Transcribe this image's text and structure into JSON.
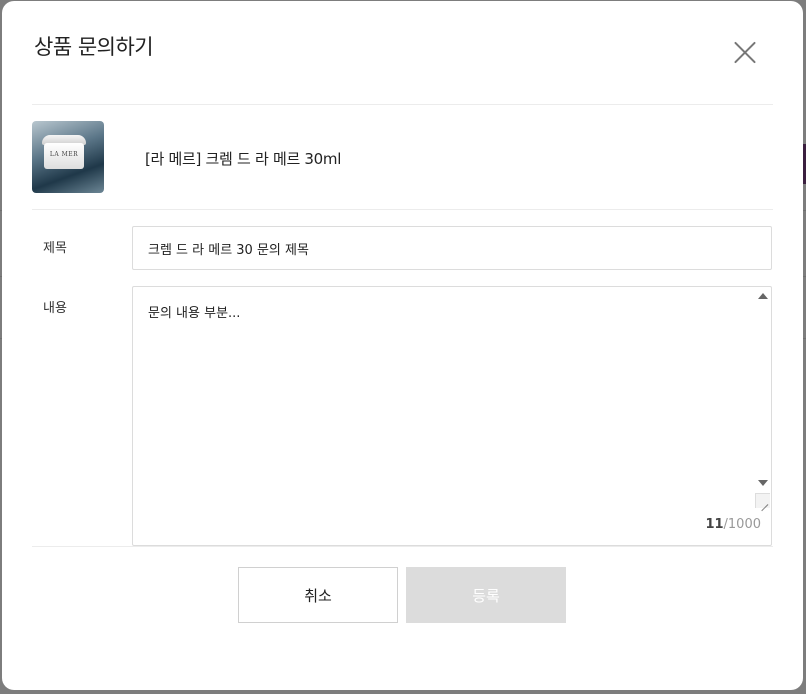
{
  "modal": {
    "title": "상품 문의하기",
    "close_icon": "close-icon"
  },
  "product": {
    "name": "[라 메르] 크렘 드 라 메르 30ml",
    "thumbnail_text": "LA MER"
  },
  "form": {
    "title_label": "제목",
    "title_value": "크렘 드 라 메르 30 문의 제목",
    "content_label": "내용",
    "content_value": "문의 내용 부분...",
    "char_count_current": "11",
    "char_count_max": "/1000"
  },
  "buttons": {
    "cancel_label": "취소",
    "submit_label": "등록"
  },
  "colors": {
    "submit_disabled_bg": "#dcdcdc",
    "border": "#dcdcdc",
    "overlay": "#7d7d7d"
  }
}
